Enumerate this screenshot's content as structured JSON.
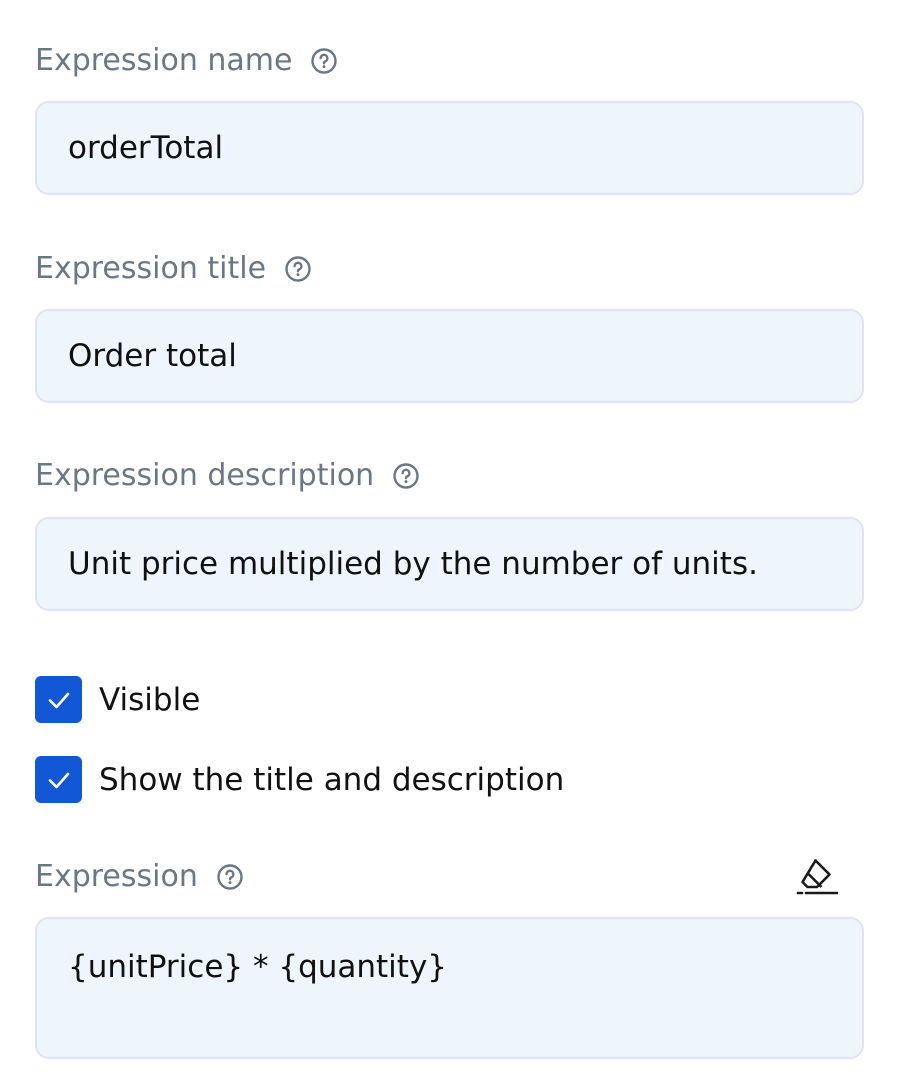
{
  "fields": {
    "name": {
      "label": "Expression name",
      "value": "orderTotal"
    },
    "title": {
      "label": "Expression title",
      "value": "Order total"
    },
    "description": {
      "label": "Expression description",
      "value": "Unit price multiplied by the number of units."
    }
  },
  "checkboxes": {
    "visible": {
      "label": "Visible",
      "checked": true
    },
    "show_title": {
      "label": "Show the title and description",
      "checked": true
    }
  },
  "expression": {
    "label": "Expression",
    "value": "{unitPrice} * {quantity}"
  },
  "icons": {
    "help": "help-circle-icon",
    "check": "checkmark-icon",
    "clear": "eraser-icon"
  },
  "colors": {
    "accent": "#1157d6",
    "input_background": "#eff5fd",
    "input_border": "#dde5ee",
    "label_text": "#6b7785",
    "body_text": "#111111"
  }
}
